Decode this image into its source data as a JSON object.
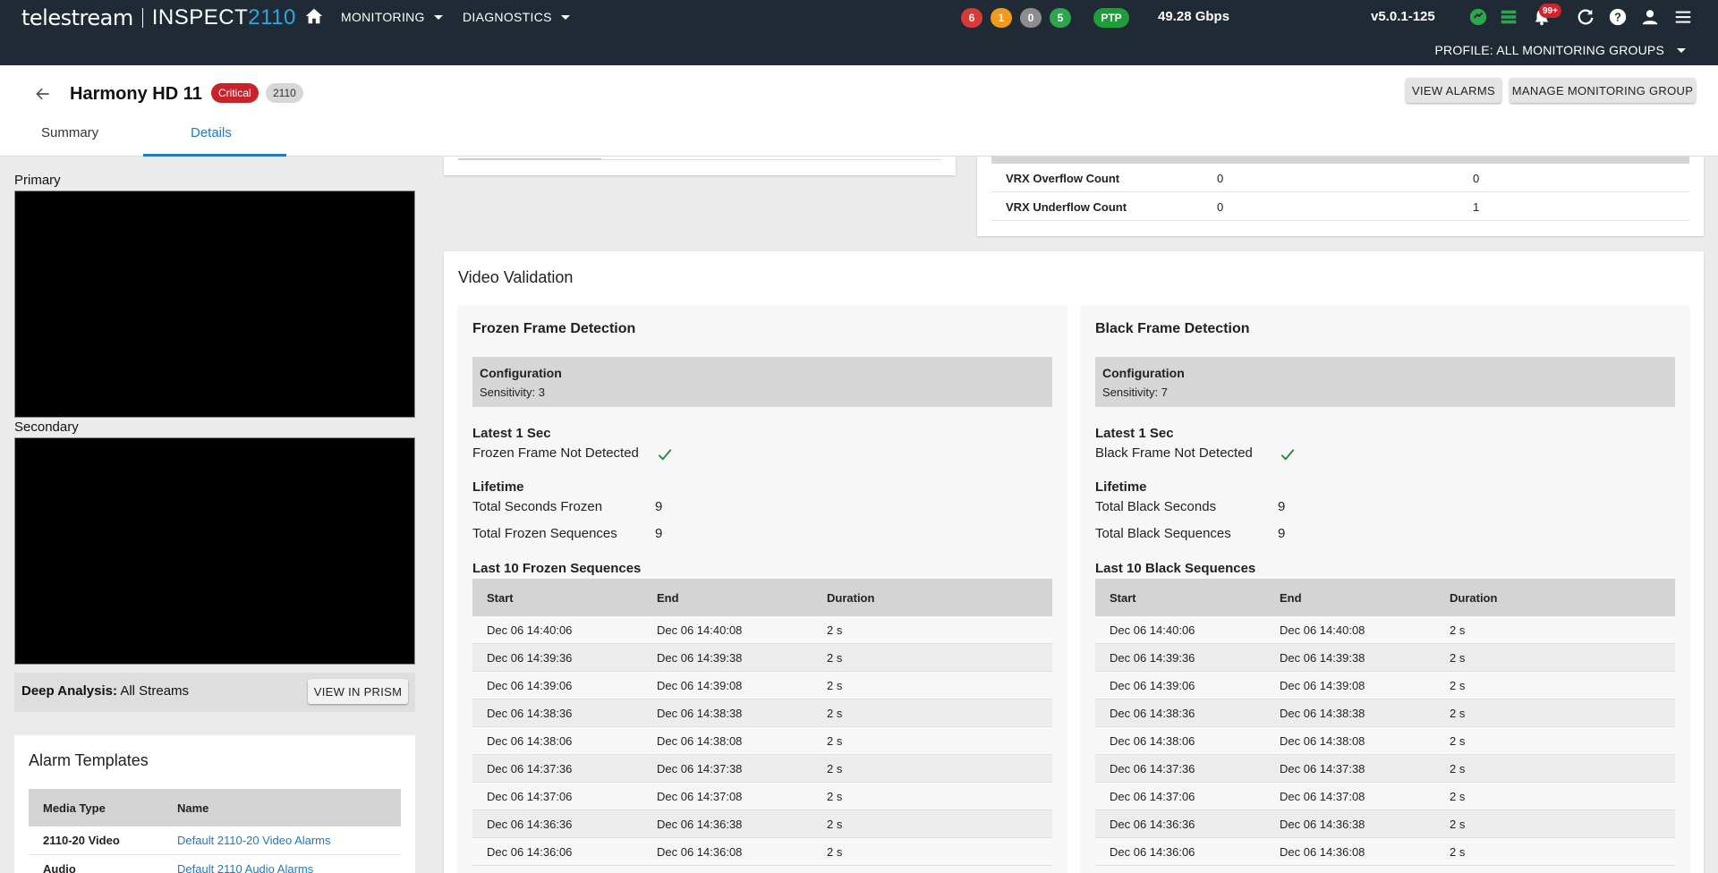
{
  "nav": {
    "brand_name": "telestream",
    "product_prefix": "INSPECT",
    "product_suffix": "2110",
    "monitoring": "MONITORING",
    "diagnostics": "DIAGNOSTICS",
    "alarm_counts": [
      {
        "value": "6",
        "color": "#d93a35"
      },
      {
        "value": "1",
        "color": "#f29a1b"
      },
      {
        "value": "0",
        "color": "#8d8d8d"
      },
      {
        "value": "5",
        "color": "#2ea44f"
      }
    ],
    "ptp": "PTP",
    "bandwidth": "49.28 Gbps",
    "version": "v5.0.1-125",
    "notification_badge": "99+",
    "profile": "PROFILE: ALL MONITORING GROUPS"
  },
  "header": {
    "title": "Harmony HD 11",
    "status_badge": "Critical",
    "type_badge": "2110",
    "view_alarms": "VIEW ALARMS",
    "manage_group": "MANAGE MONITORING GROUP",
    "tabs": [
      "Summary",
      "Details"
    ]
  },
  "left": {
    "primary_label": "Primary",
    "secondary_label": "Secondary",
    "deep_label": "Deep Analysis:",
    "deep_value": "All Streams",
    "view_prism": "VIEW IN PRISM",
    "alarm_templates": {
      "title": "Alarm Templates",
      "headers": [
        "Media Type",
        "Name"
      ],
      "rows": [
        {
          "media": "2110-20 Video",
          "name": "Default 2110-20 Video Alarms"
        },
        {
          "media": "Audio",
          "name": "Default 2110 Audio Alarms"
        }
      ]
    }
  },
  "vrx": {
    "rows": [
      {
        "name": "VRX Overflow Count",
        "v1": "0",
        "v2": "0"
      },
      {
        "name": "VRX Underflow Count",
        "v1": "0",
        "v2": "1"
      }
    ]
  },
  "video_validation": {
    "title": "Video Validation",
    "frozen": {
      "title": "Frozen Frame Detection",
      "config_label": "Configuration",
      "sensitivity": "Sensitivity:  3",
      "latest_label": "Latest 1 Sec",
      "latest_status": "Frozen Frame Not Detected",
      "lifetime_label": "Lifetime",
      "total_seconds_label": "Total Seconds Frozen",
      "total_seconds": "9",
      "total_sequences_label": "Total Frozen Sequences",
      "total_sequences": "9",
      "last10_label": "Last 10 Frozen Sequences",
      "headers": [
        "Start",
        "End",
        "Duration"
      ],
      "rows": [
        [
          "Dec 06 14:40:06",
          "Dec 06 14:40:08",
          "2 s"
        ],
        [
          "Dec 06 14:39:36",
          "Dec 06 14:39:38",
          "2 s"
        ],
        [
          "Dec 06 14:39:06",
          "Dec 06 14:39:08",
          "2 s"
        ],
        [
          "Dec 06 14:38:36",
          "Dec 06 14:38:38",
          "2 s"
        ],
        [
          "Dec 06 14:38:06",
          "Dec 06 14:38:08",
          "2 s"
        ],
        [
          "Dec 06 14:37:36",
          "Dec 06 14:37:38",
          "2 s"
        ],
        [
          "Dec 06 14:37:06",
          "Dec 06 14:37:08",
          "2 s"
        ],
        [
          "Dec 06 14:36:36",
          "Dec 06 14:36:38",
          "2 s"
        ],
        [
          "Dec 06 14:36:06",
          "Dec 06 14:36:08",
          "2 s"
        ]
      ]
    },
    "black": {
      "title": "Black Frame Detection",
      "config_label": "Configuration",
      "sensitivity": "Sensitivity:  7",
      "latest_label": "Latest 1 Sec",
      "latest_status": "Black Frame Not Detected",
      "lifetime_label": "Lifetime",
      "total_seconds_label": "Total Black Seconds",
      "total_seconds": "9",
      "total_sequences_label": "Total Black Sequences",
      "total_sequences": "9",
      "last10_label": "Last 10 Black Sequences",
      "headers": [
        "Start",
        "End",
        "Duration"
      ],
      "rows": [
        [
          "Dec 06 14:40:06",
          "Dec 06 14:40:08",
          "2 s"
        ],
        [
          "Dec 06 14:39:36",
          "Dec 06 14:39:38",
          "2 s"
        ],
        [
          "Dec 06 14:39:06",
          "Dec 06 14:39:08",
          "2 s"
        ],
        [
          "Dec 06 14:38:36",
          "Dec 06 14:38:38",
          "2 s"
        ],
        [
          "Dec 06 14:38:06",
          "Dec 06 14:38:08",
          "2 s"
        ],
        [
          "Dec 06 14:37:36",
          "Dec 06 14:37:38",
          "2 s"
        ],
        [
          "Dec 06 14:37:06",
          "Dec 06 14:37:08",
          "2 s"
        ],
        [
          "Dec 06 14:36:36",
          "Dec 06 14:36:38",
          "2 s"
        ],
        [
          "Dec 06 14:36:06",
          "Dec 06 14:36:08",
          "2 s"
        ]
      ]
    }
  }
}
